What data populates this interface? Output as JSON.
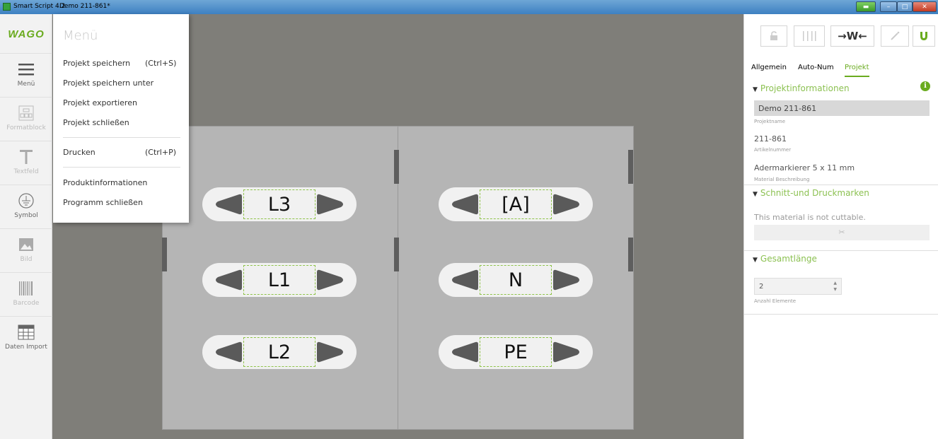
{
  "titlebar": {
    "app_name": "Smart Script 4.2",
    "doc_name": "Demo 211-861*"
  },
  "logo": "WAGO",
  "toolbar": {
    "items": [
      {
        "label": "Menü",
        "icon": "hamburger-icon"
      },
      {
        "label": "Formatblock",
        "icon": "format-block-icon"
      },
      {
        "label": "Textfeld",
        "icon": "text-icon"
      },
      {
        "label": "Symbol",
        "icon": "ground-symbol-icon"
      },
      {
        "label": "Bild",
        "icon": "image-icon"
      },
      {
        "label": "Barcode",
        "icon": "barcode-icon"
      },
      {
        "label": "Daten Import",
        "icon": "table-import-icon"
      }
    ]
  },
  "menu": {
    "title": "Menü",
    "items": [
      {
        "label": "Projekt speichern",
        "shortcut": "(Ctrl+S)"
      },
      {
        "label": "Projekt speichern unter",
        "shortcut": ""
      },
      {
        "label": "Projekt exportieren",
        "shortcut": ""
      },
      {
        "label": "Projekt schließen",
        "shortcut": ""
      },
      {
        "label": "Drucken",
        "shortcut": "(Ctrl+P)"
      },
      {
        "label": "Produktinformationen",
        "shortcut": ""
      },
      {
        "label": "Programm schließen",
        "shortcut": ""
      }
    ]
  },
  "markers": {
    "left": [
      "L3",
      "L1",
      "L2"
    ],
    "right": [
      "[A]",
      "N",
      "PE"
    ]
  },
  "right_panel": {
    "buttons": [
      "lock-icon",
      "columns-icon",
      "fit-width-icon",
      "wand-icon",
      "magnet-icon"
    ],
    "fit_width_label": "→W←",
    "tabs": [
      "Allgemein",
      "Auto-Num",
      "Projekt"
    ],
    "active_tab": "Projekt",
    "projektinfo": {
      "heading": "Projektinformationen",
      "project_name": "Demo 211-861",
      "project_name_caption": "Projektname",
      "article_number": "211-861",
      "article_number_caption": "Artikelnummer",
      "material": "Adermarkierer 5 x 11 mm",
      "material_caption": "Material Beschreibung"
    },
    "schnitt": {
      "heading": "Schnitt-und Druckmarken",
      "note": "This material is not cuttable.",
      "button_icon": "scissors-icon"
    },
    "gesamt": {
      "heading": "Gesamtlänge",
      "value": "2",
      "caption": "Anzahl Elemente"
    }
  },
  "colors": {
    "accent": "#6aab1f",
    "canvas": "#7f7e79",
    "sheet": "#b5b5b5"
  }
}
